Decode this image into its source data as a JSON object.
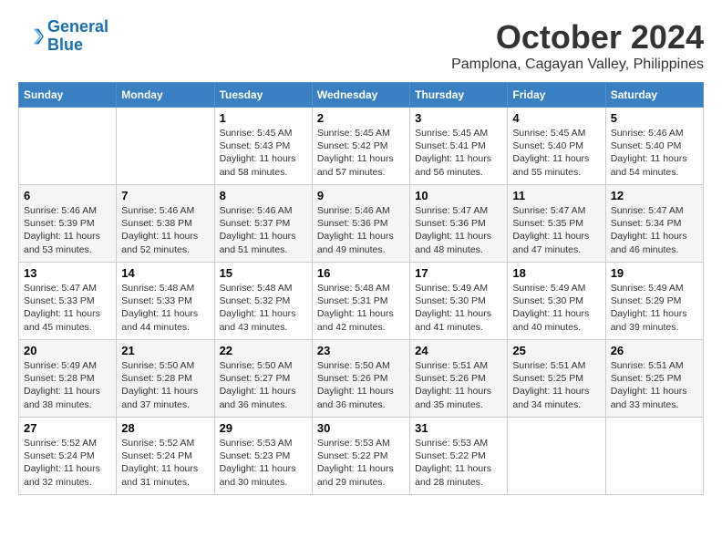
{
  "logo": {
    "line1": "General",
    "line2": "Blue"
  },
  "title": "October 2024",
  "subtitle": "Pamplona, Cagayan Valley, Philippines",
  "weekdays": [
    "Sunday",
    "Monday",
    "Tuesday",
    "Wednesday",
    "Thursday",
    "Friday",
    "Saturday"
  ],
  "weeks": [
    [
      {
        "day": "",
        "info": ""
      },
      {
        "day": "",
        "info": ""
      },
      {
        "day": "1",
        "info": "Sunrise: 5:45 AM\nSunset: 5:43 PM\nDaylight: 11 hours and 58 minutes."
      },
      {
        "day": "2",
        "info": "Sunrise: 5:45 AM\nSunset: 5:42 PM\nDaylight: 11 hours and 57 minutes."
      },
      {
        "day": "3",
        "info": "Sunrise: 5:45 AM\nSunset: 5:41 PM\nDaylight: 11 hours and 56 minutes."
      },
      {
        "day": "4",
        "info": "Sunrise: 5:45 AM\nSunset: 5:40 PM\nDaylight: 11 hours and 55 minutes."
      },
      {
        "day": "5",
        "info": "Sunrise: 5:46 AM\nSunset: 5:40 PM\nDaylight: 11 hours and 54 minutes."
      }
    ],
    [
      {
        "day": "6",
        "info": "Sunrise: 5:46 AM\nSunset: 5:39 PM\nDaylight: 11 hours and 53 minutes."
      },
      {
        "day": "7",
        "info": "Sunrise: 5:46 AM\nSunset: 5:38 PM\nDaylight: 11 hours and 52 minutes."
      },
      {
        "day": "8",
        "info": "Sunrise: 5:46 AM\nSunset: 5:37 PM\nDaylight: 11 hours and 51 minutes."
      },
      {
        "day": "9",
        "info": "Sunrise: 5:46 AM\nSunset: 5:36 PM\nDaylight: 11 hours and 49 minutes."
      },
      {
        "day": "10",
        "info": "Sunrise: 5:47 AM\nSunset: 5:36 PM\nDaylight: 11 hours and 48 minutes."
      },
      {
        "day": "11",
        "info": "Sunrise: 5:47 AM\nSunset: 5:35 PM\nDaylight: 11 hours and 47 minutes."
      },
      {
        "day": "12",
        "info": "Sunrise: 5:47 AM\nSunset: 5:34 PM\nDaylight: 11 hours and 46 minutes."
      }
    ],
    [
      {
        "day": "13",
        "info": "Sunrise: 5:47 AM\nSunset: 5:33 PM\nDaylight: 11 hours and 45 minutes."
      },
      {
        "day": "14",
        "info": "Sunrise: 5:48 AM\nSunset: 5:33 PM\nDaylight: 11 hours and 44 minutes."
      },
      {
        "day": "15",
        "info": "Sunrise: 5:48 AM\nSunset: 5:32 PM\nDaylight: 11 hours and 43 minutes."
      },
      {
        "day": "16",
        "info": "Sunrise: 5:48 AM\nSunset: 5:31 PM\nDaylight: 11 hours and 42 minutes."
      },
      {
        "day": "17",
        "info": "Sunrise: 5:49 AM\nSunset: 5:30 PM\nDaylight: 11 hours and 41 minutes."
      },
      {
        "day": "18",
        "info": "Sunrise: 5:49 AM\nSunset: 5:30 PM\nDaylight: 11 hours and 40 minutes."
      },
      {
        "day": "19",
        "info": "Sunrise: 5:49 AM\nSunset: 5:29 PM\nDaylight: 11 hours and 39 minutes."
      }
    ],
    [
      {
        "day": "20",
        "info": "Sunrise: 5:49 AM\nSunset: 5:28 PM\nDaylight: 11 hours and 38 minutes."
      },
      {
        "day": "21",
        "info": "Sunrise: 5:50 AM\nSunset: 5:28 PM\nDaylight: 11 hours and 37 minutes."
      },
      {
        "day": "22",
        "info": "Sunrise: 5:50 AM\nSunset: 5:27 PM\nDaylight: 11 hours and 36 minutes."
      },
      {
        "day": "23",
        "info": "Sunrise: 5:50 AM\nSunset: 5:26 PM\nDaylight: 11 hours and 36 minutes."
      },
      {
        "day": "24",
        "info": "Sunrise: 5:51 AM\nSunset: 5:26 PM\nDaylight: 11 hours and 35 minutes."
      },
      {
        "day": "25",
        "info": "Sunrise: 5:51 AM\nSunset: 5:25 PM\nDaylight: 11 hours and 34 minutes."
      },
      {
        "day": "26",
        "info": "Sunrise: 5:51 AM\nSunset: 5:25 PM\nDaylight: 11 hours and 33 minutes."
      }
    ],
    [
      {
        "day": "27",
        "info": "Sunrise: 5:52 AM\nSunset: 5:24 PM\nDaylight: 11 hours and 32 minutes."
      },
      {
        "day": "28",
        "info": "Sunrise: 5:52 AM\nSunset: 5:24 PM\nDaylight: 11 hours and 31 minutes."
      },
      {
        "day": "29",
        "info": "Sunrise: 5:53 AM\nSunset: 5:23 PM\nDaylight: 11 hours and 30 minutes."
      },
      {
        "day": "30",
        "info": "Sunrise: 5:53 AM\nSunset: 5:22 PM\nDaylight: 11 hours and 29 minutes."
      },
      {
        "day": "31",
        "info": "Sunrise: 5:53 AM\nSunset: 5:22 PM\nDaylight: 11 hours and 28 minutes."
      },
      {
        "day": "",
        "info": ""
      },
      {
        "day": "",
        "info": ""
      }
    ]
  ]
}
